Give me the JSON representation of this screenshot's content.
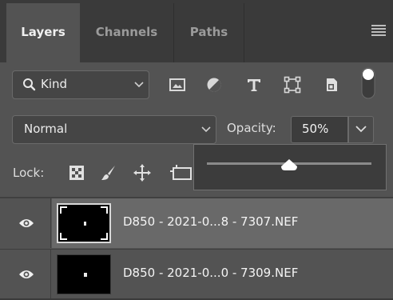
{
  "tabs": [
    {
      "label": "Layers",
      "active": true
    },
    {
      "label": "Channels",
      "active": false
    },
    {
      "label": "Paths",
      "active": false
    }
  ],
  "filter": {
    "kind_label": "Kind",
    "icons": [
      "image-filter-icon",
      "adjustment-filter-icon",
      "type-filter-icon",
      "shape-filter-icon",
      "smart-object-filter-icon",
      "filter-toggle-icon"
    ]
  },
  "blend": {
    "mode": "Normal",
    "opacity_label": "Opacity:",
    "opacity_value": "50%",
    "opacity_fraction": 0.5
  },
  "lock": {
    "label": "Lock:",
    "icons": [
      "lock-transparent-pixels-icon",
      "lock-image-pixels-icon",
      "lock-position-icon",
      "lock-artboard-icon"
    ]
  },
  "layers": [
    {
      "name": "D850 - 2021-0...8 - 7307.NEF",
      "visible": true,
      "selected": true
    },
    {
      "name": "D850 - 2021-0...0 - 7309.NEF",
      "visible": true,
      "selected": false
    }
  ],
  "colors": {
    "panel_bg": "#535353",
    "tab_strip": "#3a3a3a",
    "selected_row": "#696969",
    "text": "#e6e6e6"
  }
}
